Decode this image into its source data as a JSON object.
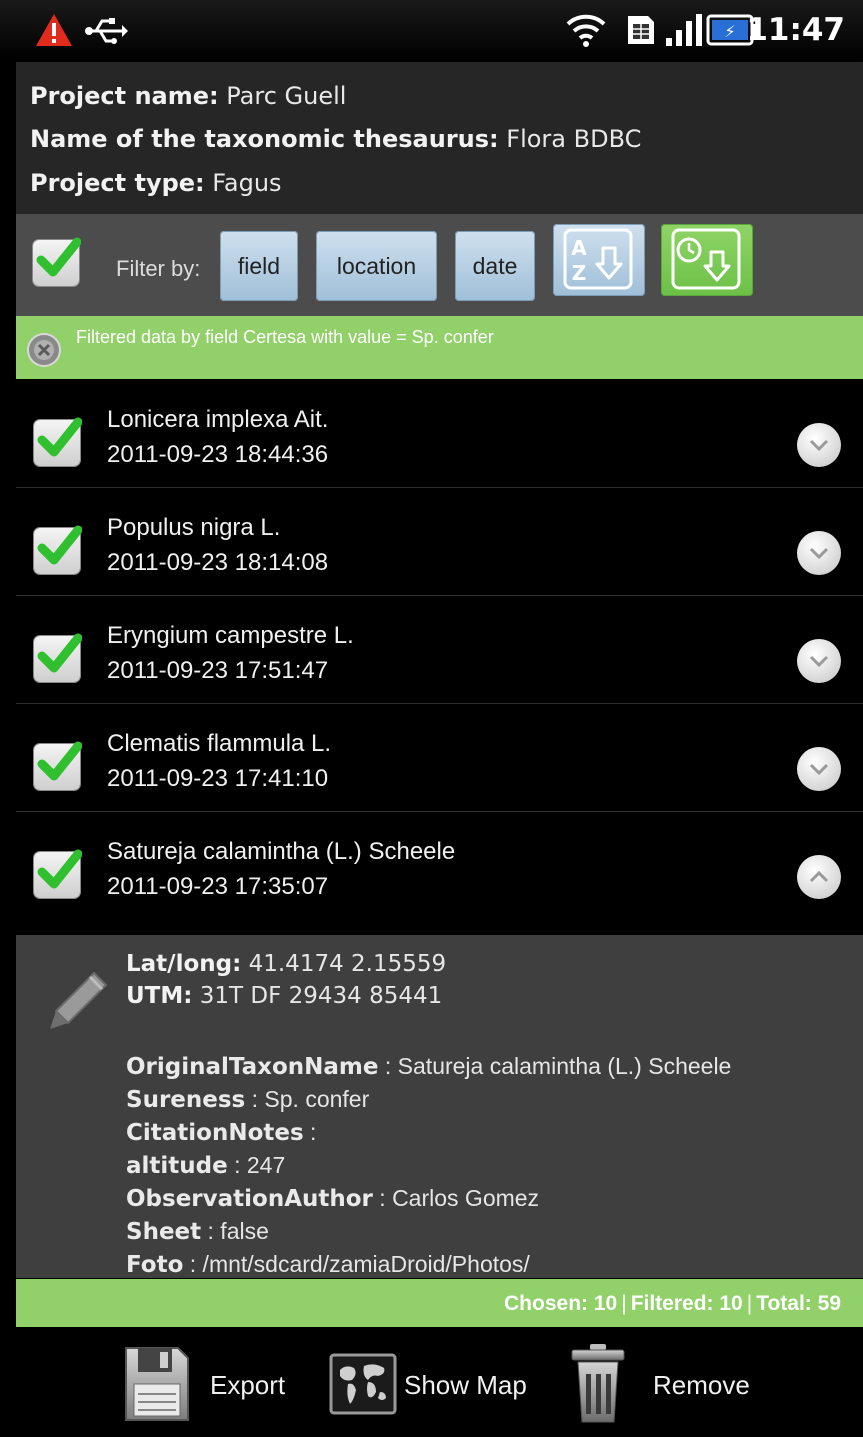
{
  "status": {
    "time": "11:47"
  },
  "project": {
    "name_label": "Project name:",
    "name_value": " Parc Guell",
    "thesaurus_label": "Name of the taxonomic thesaurus:",
    "thesaurus_value": " Flora BDBC",
    "type_label": "Project type:",
    "type_value": " Fagus"
  },
  "filter": {
    "label": "Filter by:",
    "field": "field",
    "location": "location",
    "date": "date"
  },
  "banner": {
    "text": "Filtered data by field Certesa with value = Sp. confer"
  },
  "records": [
    {
      "name": "Lonicera implexa Ait.",
      "date": "2011-09-23 18:44:36"
    },
    {
      "name": "Populus nigra L.",
      "date": "2011-09-23 18:14:08"
    },
    {
      "name": "Eryngium campestre L.",
      "date": "2011-09-23 17:51:47"
    },
    {
      "name": "Clematis flammula L.",
      "date": "2011-09-23 17:41:10"
    },
    {
      "name": "Satureja calamintha (L.) Scheele",
      "date": "2011-09-23 17:35:07"
    }
  ],
  "detail": {
    "latlong_label": "Lat/long:",
    "latlong_value": " 41.4174 2.15559",
    "utm_label": "UTM:",
    "utm_value": " 31T DF 29434 85441",
    "attributes": [
      {
        "key": "OriginalTaxonName",
        "value": " : Satureja calamintha (L.) Scheele"
      },
      {
        "key": "Sureness",
        "value": " : Sp. confer"
      },
      {
        "key": "CitationNotes",
        "value": " :"
      },
      {
        "key": "altitude",
        "value": " : 247"
      },
      {
        "key": "ObservationAuthor",
        "value": " : Carlos Gomez"
      },
      {
        "key": "Sheet",
        "value": " : false"
      },
      {
        "key": "Foto",
        "value": " : /mnt/sdcard/zamiaDroid/Photos/"
      }
    ]
  },
  "summary": {
    "chosen": "Chosen: 10",
    "filtered": "Filtered: 10",
    "total": "Total: 59"
  },
  "actions": {
    "export": "Export",
    "show_map": "Show Map",
    "remove": "Remove"
  },
  "colors": {
    "accent_green": "#92d06a",
    "filter_button": "#b7d0e4",
    "sort_date_button": "#7fc95a"
  }
}
